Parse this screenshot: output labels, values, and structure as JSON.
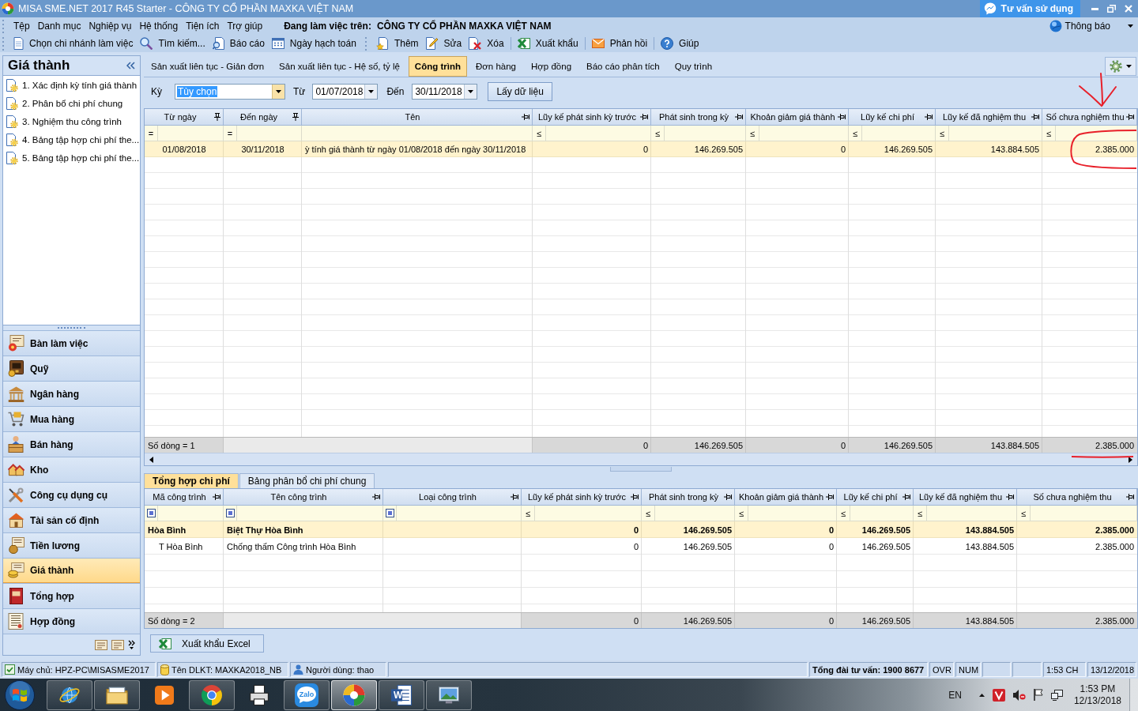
{
  "window": {
    "title": "MISA SME.NET 2017 R45 Starter - CÔNG TY CỔ PHẦN MAXKA VIỆT NAM",
    "support_button": "Tư vấn sử dụng"
  },
  "menu_bar": {
    "items": [
      "Tệp",
      "Danh mục",
      "Nghiệp vụ",
      "Hệ thống",
      "Tiện ích",
      "Trợ giúp"
    ],
    "workspace_label": "Đang làm việc trên:",
    "workspace_company": "CÔNG TY CỔ PHẦN MAXKA VIỆT NAM",
    "notifications": "Thông báo"
  },
  "toolbar": {
    "groups": [
      [
        "Chọn chi nhánh làm việc",
        "Tìm kiếm...",
        "Báo cáo",
        "Ngày hạch toán"
      ],
      [
        "Thêm",
        "Sửa",
        "Xóa"
      ],
      [
        "Xuất khẩu"
      ],
      [
        "Phản hồi"
      ],
      [
        "Giúp"
      ]
    ]
  },
  "sidebar": {
    "title": "Giá thành",
    "items": [
      "1. Xác định kỳ tính giá thành",
      "2. Phân bổ chi phí chung",
      "3. Nghiệm thu công trình",
      "4. Bảng tập hợp chi phí the...",
      "5. Bảng tập hợp chi phí the..."
    ],
    "modules": [
      {
        "label": "Bàn làm việc",
        "selected": false
      },
      {
        "label": "Quỹ",
        "selected": false
      },
      {
        "label": "Ngân hàng",
        "selected": false
      },
      {
        "label": "Mua hàng",
        "selected": false
      },
      {
        "label": "Bán hàng",
        "selected": false
      },
      {
        "label": "Kho",
        "selected": false
      },
      {
        "label": "Công cụ dụng cụ",
        "selected": false
      },
      {
        "label": "Tài sản cố định",
        "selected": false
      },
      {
        "label": "Tiền lương",
        "selected": false
      },
      {
        "label": "Giá thành",
        "selected": true
      },
      {
        "label": "Tổng hợp",
        "selected": false
      },
      {
        "label": "Hợp đồng",
        "selected": false
      }
    ]
  },
  "tabs": [
    {
      "label": "Sản xuất liên tục - Giản đơn",
      "selected": false
    },
    {
      "label": "Sản xuất liên tục - Hệ số, tỷ lệ",
      "selected": false
    },
    {
      "label": "Công trình",
      "selected": true
    },
    {
      "label": "Đơn hàng",
      "selected": false
    },
    {
      "label": "Hợp đồng",
      "selected": false
    },
    {
      "label": "Báo cáo phân tích",
      "selected": false
    },
    {
      "label": "Quy trình",
      "selected": false
    }
  ],
  "filters": {
    "period_label": "Kỳ",
    "period": "Tùy chọn",
    "period_highlighted": true,
    "from_label": "Từ",
    "from": "01/07/2018",
    "to_label": "Đến",
    "to": "30/11/2018",
    "button": "Lấy dữ liệu"
  },
  "period_table": {
    "columns": [
      {
        "label": "Từ ngày",
        "kind": "date",
        "pinned": true
      },
      {
        "label": "Đến ngày",
        "kind": "date",
        "pinned": true
      },
      {
        "label": "Tên",
        "kind": "text",
        "pinned": false
      },
      {
        "label": "Lũy kế phát sinh kỳ trước",
        "kind": "number",
        "pinned": false
      },
      {
        "label": "Phát sinh trong kỳ",
        "kind": "number",
        "pinned": false
      },
      {
        "label": "Khoản giảm giá thành",
        "kind": "number",
        "pinned": false
      },
      {
        "label": "Lũy kế chi phí",
        "kind": "number",
        "pinned": false
      },
      {
        "label": "Lũy kế đã nghiệm thu",
        "kind": "number",
        "pinned": false
      },
      {
        "label": "Số chưa nghiệm thu",
        "kind": "number",
        "pinned": false
      }
    ],
    "filter_row": [
      {
        "kind": "symbol",
        "symbol": "="
      },
      {
        "kind": "symbol",
        "symbol": "="
      },
      {
        "kind": "blank"
      },
      {
        "kind": "symbol",
        "symbol": "≤"
      },
      {
        "kind": "symbol",
        "symbol": "≤"
      },
      {
        "kind": "symbol",
        "symbol": "≤"
      },
      {
        "kind": "symbol",
        "symbol": "≤"
      },
      {
        "kind": "symbol",
        "symbol": "≤"
      },
      {
        "kind": "symbol",
        "symbol": "≤"
      }
    ],
    "rows": [
      {
        "from_date": "01/08/2018",
        "to_date": "30/11/2018",
        "name": "ỳ tính giá thành từ ngày 01/08/2018 đến ngày 30/11/2018",
        "prior_accumulated": "0",
        "in_period": "146.269.505",
        "reduction": "0",
        "accumulated_cost": "146.269.505",
        "accepted": "143.884.505",
        "not_accepted": "2.385.000",
        "selected": true
      }
    ],
    "footer": {
      "label": "Số dòng = 1",
      "prior_accumulated": "0",
      "in_period": "146.269.505",
      "reduction": "0",
      "accumulated_cost": "146.269.505",
      "accepted": "143.884.505",
      "not_accepted": "2.385.000"
    }
  },
  "detail_tabs": [
    {
      "label": "Tổng hợp chi phí",
      "selected": true
    },
    {
      "label": "Bảng phân bổ chi phí chung",
      "selected": false
    }
  ],
  "detail_table": {
    "columns": [
      {
        "label": "Mã công trình",
        "kind": "text",
        "pinned": false
      },
      {
        "label": "Tên công trình",
        "kind": "text",
        "pinned": false
      },
      {
        "label": "Loại công trình",
        "kind": "text",
        "pinned": false
      },
      {
        "label": "Lũy kế phát sinh kỳ trước",
        "kind": "number",
        "pinned": false
      },
      {
        "label": "Phát sinh trong kỳ",
        "kind": "number",
        "pinned": false
      },
      {
        "label": "Khoản giảm giá thành",
        "kind": "number",
        "pinned": false
      },
      {
        "label": "Lũy kế chi phí",
        "kind": "number",
        "pinned": false
      },
      {
        "label": "Lũy kế đã nghiệm thu",
        "kind": "number",
        "pinned": false
      },
      {
        "label": "Số chưa nghiệm thu",
        "kind": "number",
        "pinned": false
      }
    ],
    "filter_row": [
      {
        "kind": "icon"
      },
      {
        "kind": "icon"
      },
      {
        "kind": "icon"
      },
      {
        "kind": "symbol",
        "symbol": "≤"
      },
      {
        "kind": "symbol",
        "symbol": "≤"
      },
      {
        "kind": "symbol",
        "symbol": "≤"
      },
      {
        "kind": "symbol",
        "symbol": "≤"
      },
      {
        "kind": "symbol",
        "symbol": "≤"
      },
      {
        "kind": "symbol",
        "symbol": "≤"
      }
    ],
    "rows": [
      {
        "code": "Hòa Bình",
        "name": "Biệt Thự Hòa Bình",
        "prior_accumulated": "0",
        "in_period": "146.269.505",
        "reduction": "0",
        "accumulated_cost": "146.269.505",
        "accepted": "143.884.505",
        "not_accepted": "2.385.000",
        "selected": true,
        "children": [
          {
            "code": "T Hòa Bình",
            "name": "Chống thấm Công trình Hòa Bình",
            "prior_accumulated": "0",
            "in_period": "146.269.505",
            "reduction": "0",
            "accumulated_cost": "146.269.505",
            "accepted": "143.884.505",
            "not_accepted": "2.385.000",
            "selected": false
          }
        ]
      }
    ],
    "footer": {
      "label": "Số dòng = 2",
      "prior_accumulated": "0",
      "in_period": "146.269.505",
      "reduction": "0",
      "accumulated_cost": "146.269.505",
      "accepted": "143.884.505",
      "not_accepted": "2.385.000"
    }
  },
  "export_button": "Xuất khẩu Excel",
  "status_bar": [
    {
      "kind": "server",
      "text": "Máy chủ: HPZ-PC\\MISASME2017"
    },
    {
      "kind": "database",
      "text": "Tên DLKT: MAXKA2018_NB"
    },
    {
      "kind": "user",
      "text": "Người dùng: thao"
    },
    {
      "kind": "empty"
    },
    {
      "kind": "bold",
      "text": "Tổng đài tư vấn: 1900 8677"
    },
    {
      "kind": "plain",
      "text": "OVR"
    },
    {
      "kind": "plain",
      "text": "NUM"
    },
    {
      "kind": "empty"
    },
    {
      "kind": "empty"
    },
    {
      "kind": "plain",
      "text": "1:53 CH"
    },
    {
      "kind": "plain",
      "text": "13/12/2018"
    }
  ],
  "taskbar": {
    "apps": [
      {
        "kind": "globe",
        "running": true,
        "selected": false
      },
      {
        "kind": "folder",
        "running": true,
        "selected": false
      },
      {
        "kind": "player",
        "running": false,
        "selected": false
      },
      {
        "kind": "wheel",
        "running": true,
        "selected": false
      },
      {
        "kind": "printer",
        "running": false,
        "selected": false
      },
      {
        "kind": "chat",
        "label": "Zalo",
        "running": true,
        "selected": false
      },
      {
        "kind": "pinwheel",
        "running": true,
        "selected": true
      },
      {
        "kind": "document",
        "label": "W",
        "running": true,
        "selected": false
      },
      {
        "kind": "picture",
        "running": true,
        "selected": false
      }
    ],
    "language": "EN",
    "time": "1:53 PM",
    "date": "12/13/2018"
  }
}
